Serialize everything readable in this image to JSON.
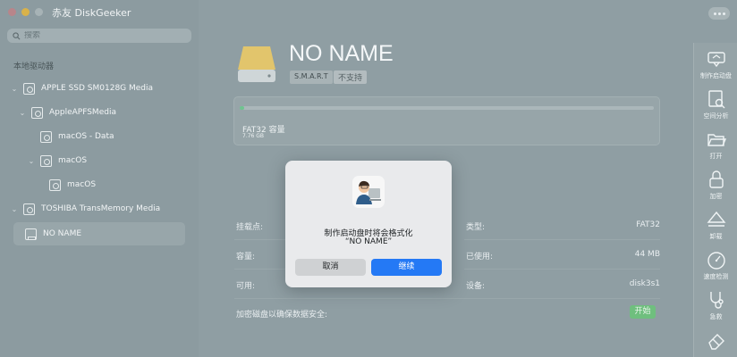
{
  "app": {
    "title": "赤友 DiskGeeker"
  },
  "search": {
    "placeholder": "搜索"
  },
  "sidebar": {
    "section_label": "本地驱动器",
    "items": [
      {
        "label": "APPLE SSD SM0128G Media"
      },
      {
        "label": "AppleAPFSMedia"
      },
      {
        "label": "macOS - Data"
      },
      {
        "label": "macOS"
      },
      {
        "label": "macOS"
      },
      {
        "label": "TOSHIBA TransMemory Media"
      },
      {
        "label": "NO NAME"
      }
    ]
  },
  "disk": {
    "name": "NO NAME",
    "smart_badge": "S.M.A.R.T",
    "smart_status": "不支持",
    "capacity_title": "FAT32 容量",
    "capacity_size": "7.76 GB",
    "capacity_used_fraction": 0.01
  },
  "info": {
    "mount_label": "挂载点:",
    "type_label": "类型:",
    "type_value": "FAT32",
    "capacity_label": "容量:",
    "used_label": "已使用:",
    "used_value": "44 MB",
    "available_label": "可用:",
    "device_label": "设备:",
    "device_value": "disk3s1",
    "encrypt_label": "加密磁盘以确保数据安全:",
    "encrypt_button": "开始"
  },
  "toolbar": {
    "items": [
      {
        "label": "制作启动盘",
        "icon": "boot-drive-icon"
      },
      {
        "label": "空间分析",
        "icon": "space-analysis-icon"
      },
      {
        "label": "打开",
        "icon": "folder-open-icon"
      },
      {
        "label": "加密",
        "icon": "lock-icon"
      },
      {
        "label": "卸载",
        "icon": "eject-icon"
      },
      {
        "label": "速度检测",
        "icon": "speedometer-icon"
      },
      {
        "label": "急救",
        "icon": "stethoscope-icon"
      },
      {
        "label": "",
        "icon": "eraser-icon"
      }
    ]
  },
  "dialog": {
    "line1": "制作启动盘时将会格式化",
    "line2": "“NO NAME”",
    "cancel": "取消",
    "confirm": "继续"
  },
  "colors": {
    "background": "#8f9ea3",
    "accent_blue": "#2479f5",
    "green": "#6fbf7e",
    "disk_yellow": "#e2c56c"
  }
}
